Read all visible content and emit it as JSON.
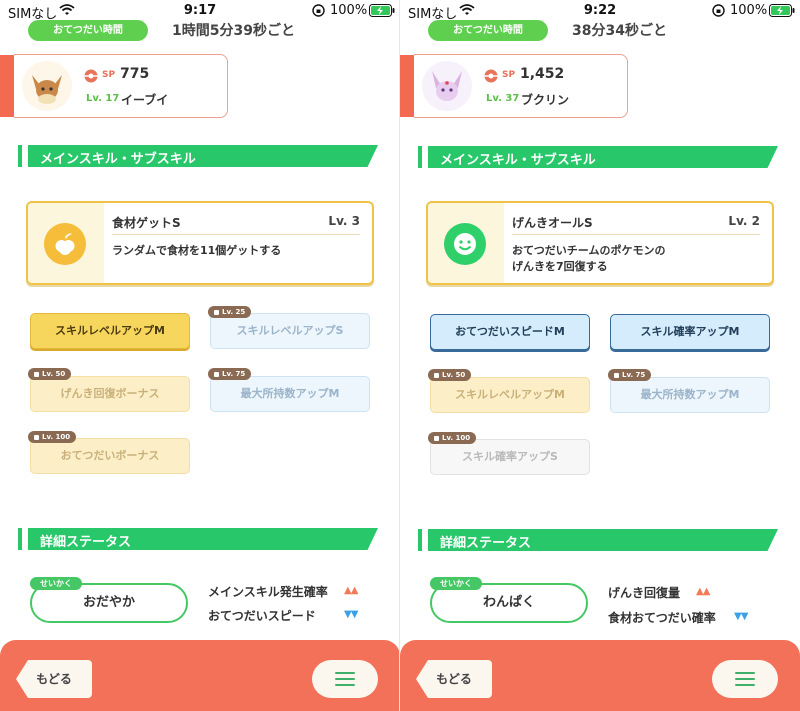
{
  "left": {
    "status": {
      "carrier": "SIMなし",
      "time": "9:17",
      "battery": "100%"
    },
    "help_tag": "おてつだい時間",
    "help_interval": "1時間5分39秒ごと",
    "pokemon": {
      "sp_label": "SP",
      "sp_value": "775",
      "level": "Lv. 17",
      "name": "イーブイ",
      "avatar_color": "#c8894a"
    },
    "section_skill": "メインスキル・サブスキル",
    "main_skill": {
      "name": "食材ゲットS",
      "level": "Lv. 3",
      "desc": "ランダムで食材を11個ゲットする",
      "icon_color": "#f5bd39"
    },
    "sub_skills": [
      {
        "label": "スキルレベルアップM",
        "badge": ""
      },
      {
        "label": "スキルレベルアップS",
        "badge": "Lv. 25"
      },
      {
        "label": "げんき回復ボーナス",
        "badge": "Lv. 50"
      },
      {
        "label": "最大所持数アップM",
        "badge": "Lv. 75"
      },
      {
        "label": "おてつだいボーナス",
        "badge": "Lv. 100"
      }
    ],
    "section_detail": "詳細ステータス",
    "nature_tag": "せいかく",
    "nature": "おだやか",
    "effects": [
      {
        "label": "メインスキル発生確率",
        "arrows": "▲▲"
      },
      {
        "label": "おてつだいスピード",
        "arrows": "▼▼"
      }
    ],
    "footer": {
      "back": "もどる"
    }
  },
  "right": {
    "status": {
      "carrier": "SIMなし",
      "time": "9:22",
      "battery": "100%"
    },
    "help_tag": "おてつだい時間",
    "help_interval": "38分34秒ごと",
    "pokemon": {
      "sp_label": "SP",
      "sp_value": "1,452",
      "level": "Lv. 37",
      "name": "ブクリン",
      "avatar_color": "#d9b4e3"
    },
    "section_skill": "メインスキル・サブスキル",
    "main_skill": {
      "name": "げんきオールS",
      "level": "Lv. 2",
      "desc_1": "おてつだいチームのポケモンの",
      "desc_2": "げんきを7回復する",
      "icon_color": "#2fcf6a"
    },
    "sub_skills": [
      {
        "label": "おてつだいスピードM",
        "badge": ""
      },
      {
        "label": "スキル確率アップM",
        "badge": ""
      },
      {
        "label": "スキルレベルアップM",
        "badge": "Lv. 50"
      },
      {
        "label": "最大所持数アップM",
        "badge": "Lv. 75"
      },
      {
        "label": "スキル確率アップS",
        "badge": "Lv. 100"
      }
    ],
    "section_detail": "詳細ステータス",
    "nature_tag": "せいかく",
    "nature": "わんぱく",
    "effects": [
      {
        "label": "げんき回復量",
        "arrows": "▲▲"
      },
      {
        "label": "食材おてつだい確率",
        "arrows": "▼▼"
      }
    ],
    "footer": {
      "back": "もどる"
    }
  }
}
